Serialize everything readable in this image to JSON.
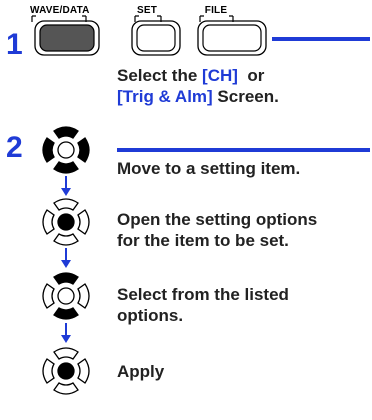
{
  "step1": {
    "number": "1",
    "keys": [
      {
        "label": "WAVE/DATA",
        "pressed": true
      },
      {
        "label": "SET",
        "pressed": false
      },
      {
        "label": "FILE",
        "pressed": false
      }
    ],
    "instruction": {
      "line1_pre": "Select the ",
      "line1_hl": "[CH]",
      "line1_post": "  or",
      "line2_hl": "[Trig & Alm]",
      "line2_post": " Screen."
    }
  },
  "step2": {
    "number": "2",
    "actions": [
      {
        "line1": "Move to a setting item.",
        "line2": ""
      },
      {
        "line1": "Open the setting options",
        "line2": "for the item to be set."
      },
      {
        "line1": "Select from the listed",
        "line2": "options."
      },
      {
        "line1": "Apply",
        "line2": ""
      }
    ]
  },
  "colors": {
    "accent_blue": "#1f3bd6",
    "pressed_key": "#555555",
    "text": "#222222"
  },
  "icons": [
    "cursor-pad-icon",
    "arrow-down-icon"
  ]
}
